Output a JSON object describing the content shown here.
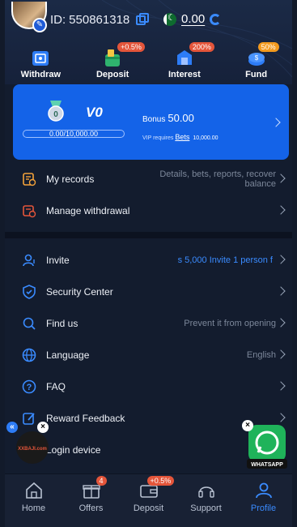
{
  "header": {
    "uid_prefix": "ID:",
    "uid": "550861318",
    "balance": "0.00"
  },
  "quick_actions": [
    {
      "label": "Withdraw",
      "badge": ""
    },
    {
      "label": "Deposit",
      "badge": "+0.5%"
    },
    {
      "label": "Interest",
      "badge": "200%"
    },
    {
      "label": "Fund",
      "badge": "50%"
    }
  ],
  "vip": {
    "level": "V0",
    "medal_number": "0",
    "progress": "0.00/10,000.00",
    "bonus_label": "Bonus",
    "bonus_value": "50.00",
    "requires_label": "VIP requires",
    "requires_link": "Bets",
    "requires_amount": "10,000.00"
  },
  "menu_top": [
    {
      "title": "My records",
      "sub": "Details, bets, reports, recover balance"
    },
    {
      "title": "Manage withdrawal",
      "sub": ""
    }
  ],
  "menu_bottom": [
    {
      "title": "Invite",
      "sub": "s 5,000 Invite 1 person f"
    },
    {
      "title": "Security Center",
      "sub": ""
    },
    {
      "title": "Find us",
      "sub": "Prevent it from opening"
    },
    {
      "title": "Language",
      "sub": "English"
    },
    {
      "title": "FAQ",
      "sub": ""
    },
    {
      "title": "Reward Feedback",
      "sub": ""
    },
    {
      "title": "Login device",
      "sub": ""
    }
  ],
  "bottom_nav": [
    {
      "label": "Home",
      "badge": ""
    },
    {
      "label": "Offers",
      "badge": "4"
    },
    {
      "label": "Deposit",
      "badge": "+0.5%"
    },
    {
      "label": "Support",
      "badge": ""
    },
    {
      "label": "Profile",
      "badge": ""
    }
  ],
  "floating": {
    "left_logo_text": "XXBAJI.com",
    "right_label": "WHATSAPP"
  },
  "colors": {
    "accent": "#3a8bff",
    "card": "#1463e8",
    "background": "#131c2e"
  }
}
